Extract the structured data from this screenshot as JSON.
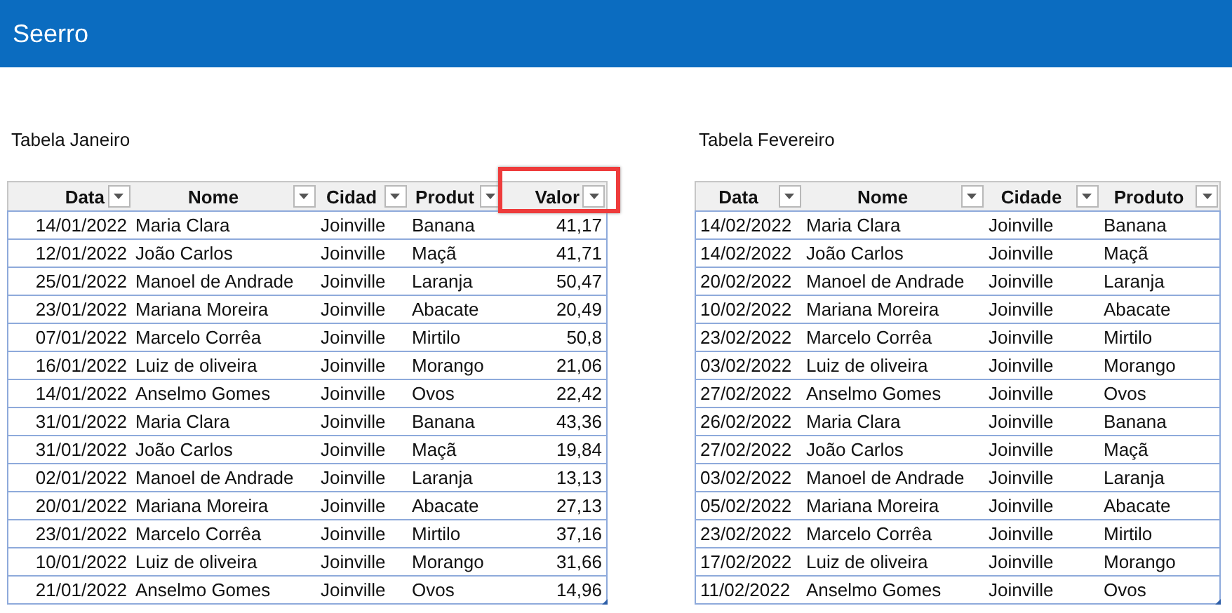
{
  "header": {
    "title": "Seerro"
  },
  "tables": [
    {
      "title": "Tabela Janeiro",
      "columns": [
        {
          "label": "Data",
          "highlighted": false
        },
        {
          "label": "Nome",
          "highlighted": false
        },
        {
          "label": "Cidad",
          "highlighted": false
        },
        {
          "label": "Produt",
          "highlighted": false
        },
        {
          "label": "Valor",
          "highlighted": true
        }
      ],
      "rows": [
        [
          "14/01/2022",
          "Maria Clara",
          "Joinville",
          "Banana",
          "41,17"
        ],
        [
          "12/01/2022",
          "João Carlos",
          "Joinville",
          "Maçã",
          "41,71"
        ],
        [
          "25/01/2022",
          "Manoel de Andrade",
          "Joinville",
          "Laranja",
          "50,47"
        ],
        [
          "23/01/2022",
          "Mariana Moreira",
          "Joinville",
          "Abacate",
          "20,49"
        ],
        [
          "07/01/2022",
          "Marcelo Corrêa",
          "Joinville",
          "Mirtilo",
          "50,8"
        ],
        [
          "16/01/2022",
          "Luiz de oliveira",
          "Joinville",
          "Morango",
          "21,06"
        ],
        [
          "14/01/2022",
          "Anselmo Gomes",
          "Joinville",
          "Ovos",
          "22,42"
        ],
        [
          "31/01/2022",
          "Maria Clara",
          "Joinville",
          "Banana",
          "43,36"
        ],
        [
          "31/01/2022",
          "João Carlos",
          "Joinville",
          "Maçã",
          "19,84"
        ],
        [
          "02/01/2022",
          "Manoel de Andrade",
          "Joinville",
          "Laranja",
          "13,13"
        ],
        [
          "20/01/2022",
          "Mariana Moreira",
          "Joinville",
          "Abacate",
          "27,13"
        ],
        [
          "23/01/2022",
          "Marcelo Corrêa",
          "Joinville",
          "Mirtilo",
          "37,16"
        ],
        [
          "10/01/2022",
          "Luiz de oliveira",
          "Joinville",
          "Morango",
          "31,66"
        ],
        [
          "21/01/2022",
          "Anselmo Gomes",
          "Joinville",
          "Ovos",
          "14,96"
        ]
      ]
    },
    {
      "title": "Tabela Fevereiro",
      "columns": [
        {
          "label": "Data",
          "highlighted": false
        },
        {
          "label": "Nome",
          "highlighted": false
        },
        {
          "label": "Cidade",
          "highlighted": false
        },
        {
          "label": "Produto",
          "highlighted": false
        }
      ],
      "rows": [
        [
          "14/02/2022",
          "Maria Clara",
          "Joinville",
          "Banana"
        ],
        [
          "14/02/2022",
          "João Carlos",
          "Joinville",
          "Maçã"
        ],
        [
          "20/02/2022",
          "Manoel de Andrade",
          "Joinville",
          "Laranja"
        ],
        [
          "10/02/2022",
          "Mariana Moreira",
          "Joinville",
          "Abacate"
        ],
        [
          "23/02/2022",
          "Marcelo Corrêa",
          "Joinville",
          "Mirtilo"
        ],
        [
          "03/02/2022",
          "Luiz de oliveira",
          "Joinville",
          "Morango"
        ],
        [
          "27/02/2022",
          "Anselmo Gomes",
          "Joinville",
          "Ovos"
        ],
        [
          "26/02/2022",
          "Maria Clara",
          "Joinville",
          "Banana"
        ],
        [
          "27/02/2022",
          "João Carlos",
          "Joinville",
          "Maçã"
        ],
        [
          "03/02/2022",
          "Manoel de Andrade",
          "Joinville",
          "Laranja"
        ],
        [
          "05/02/2022",
          "Mariana Moreira",
          "Joinville",
          "Abacate"
        ],
        [
          "23/02/2022",
          "Marcelo Corrêa",
          "Joinville",
          "Mirtilo"
        ],
        [
          "17/02/2022",
          "Luiz de oliveira",
          "Joinville",
          "Morango"
        ],
        [
          "11/02/2022",
          "Anselmo Gomes",
          "Joinville",
          "Ovos"
        ]
      ]
    }
  ]
}
